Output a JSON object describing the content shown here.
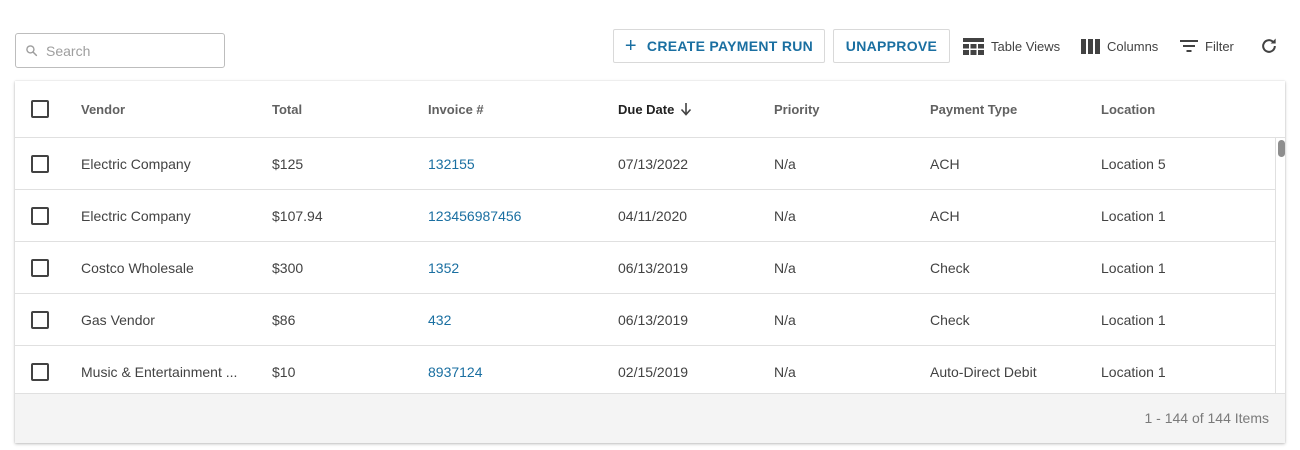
{
  "search": {
    "placeholder": "Search",
    "value": ""
  },
  "toolbar": {
    "create_label": "CREATE PAYMENT RUN",
    "unapprove_label": "UNAPPROVE",
    "table_views_label": "Table Views",
    "columns_label": "Columns",
    "filter_label": "Filter"
  },
  "columns": {
    "vendor": "Vendor",
    "total": "Total",
    "invoice": "Invoice #",
    "due_date": "Due Date",
    "priority": "Priority",
    "payment_type": "Payment Type",
    "location": "Location"
  },
  "rows": [
    {
      "vendor": "Electric Company",
      "total": "$125",
      "invoice": "132155",
      "due_date": "07/13/2022",
      "priority": "N/a",
      "payment_type": "ACH",
      "location": "Location 5"
    },
    {
      "vendor": "Electric Company",
      "total": "$107.94",
      "invoice": "123456987456",
      "due_date": "04/11/2020",
      "priority": "N/a",
      "payment_type": "ACH",
      "location": "Location 1"
    },
    {
      "vendor": "Costco Wholesale",
      "total": "$300",
      "invoice": "1352",
      "due_date": "06/13/2019",
      "priority": "N/a",
      "payment_type": "Check",
      "location": "Location 1"
    },
    {
      "vendor": "Gas Vendor",
      "total": "$86",
      "invoice": "432",
      "due_date": "06/13/2019",
      "priority": "N/a",
      "payment_type": "Check",
      "location": "Location 1"
    },
    {
      "vendor": "Music & Entertainment ...",
      "total": "$10",
      "invoice": "8937124",
      "due_date": "02/15/2019",
      "priority": "N/a",
      "payment_type": "Auto-Direct Debit",
      "location": "Location 1"
    }
  ],
  "footer": {
    "count": "1 - 144 of 144 Items"
  },
  "colors": {
    "accent": "#1a6fa1",
    "footer_bg": "#f4f4f4",
    "border": "#e0e0e0"
  }
}
